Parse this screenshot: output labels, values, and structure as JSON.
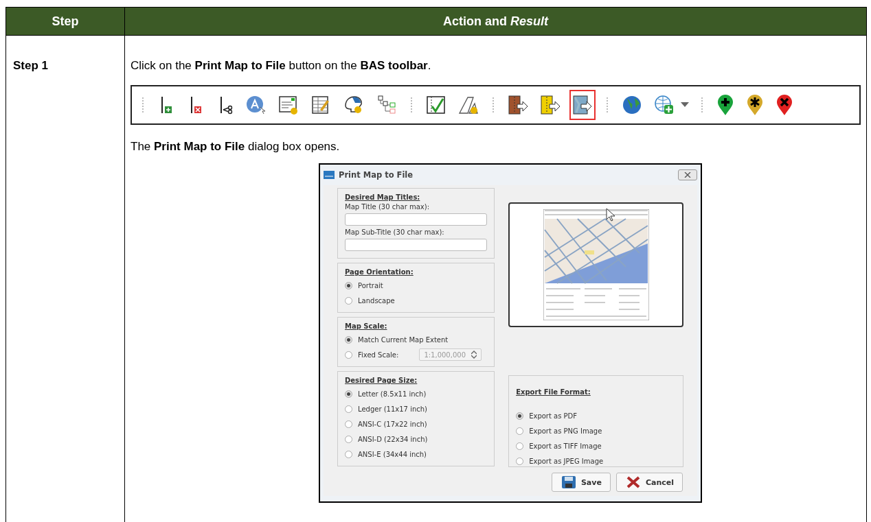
{
  "table": {
    "columns": [
      "Step",
      "Action and *Result*"
    ],
    "rows": [
      {
        "step": "Step 1",
        "instruction": "Click on the **Print Map to File** button on the **BAS toolbar**.",
        "toolbar": {
          "groups": [
            {
              "buttons": [
                {
                  "kind": "line-add",
                  "highlighted": false
                },
                {
                  "kind": "line-delete",
                  "highlighted": false
                },
                {
                  "kind": "line-split",
                  "highlighted": false
                },
                {
                  "kind": "label",
                  "highlighted": false
                },
                {
                  "kind": "form",
                  "highlighted": false
                },
                {
                  "kind": "table",
                  "highlighted": false
                },
                {
                  "kind": "boundary",
                  "highlighted": false
                },
                {
                  "kind": "tree",
                  "highlighted": false
                }
              ]
            },
            {
              "buttons": [
                {
                  "kind": "check",
                  "highlighted": false
                },
                {
                  "kind": "polygon",
                  "highlighted": false
                }
              ]
            },
            {
              "buttons": [
                {
                  "kind": "import",
                  "highlighted": false
                },
                {
                  "kind": "export",
                  "highlighted": false
                },
                {
                  "kind": "print",
                  "highlighted": true
                }
              ]
            },
            {
              "buttons": [
                {
                  "kind": "globe",
                  "highlighted": false
                },
                {
                  "kind": "web-add",
                  "highlighted": false
                },
                {
                  "kind": "dropdown",
                  "highlighted": false
                }
              ]
            },
            {
              "buttons": [
                {
                  "kind": "pin-add",
                  "highlighted": false
                },
                {
                  "kind": "pin-star",
                  "highlighted": false
                },
                {
                  "kind": "pin-remove",
                  "highlighted": false
                }
              ]
            }
          ]
        },
        "result": "The **Print Map to File** dialog box opens.",
        "dialog": {
          "title": "Print Map to File",
          "titles_group": {
            "heading": "Desired Map Titles:",
            "fields": [
              {
                "label": "Map Title (30 char max):"
              },
              {
                "label": "Map Sub-Title (30 char max):"
              }
            ]
          },
          "orientation_group": {
            "heading": "Page Orientation:",
            "options": [
              {
                "label": "Portrait",
                "selected": true
              },
              {
                "label": "Landscape",
                "selected": false
              }
            ]
          },
          "scale_group": {
            "heading": "Map Scale:",
            "options": [
              {
                "label": "Match Current Map Extent",
                "selected": true
              },
              {
                "label": "Fixed Scale:",
                "selected": false
              }
            ],
            "scale_value": "1:1,000,000",
            "scale_disabled": true
          },
          "page_size_group": {
            "heading": "Desired Page Size:",
            "options": [
              {
                "label": "Letter (8.5x11 inch)",
                "selected": true
              },
              {
                "label": "Ledger (11x17 inch)",
                "selected": false
              },
              {
                "label": "ANSI-C (17x22 inch)",
                "selected": false
              },
              {
                "label": "ANSI-D (22x34 inch)",
                "selected": false
              },
              {
                "label": "ANSI-E (34x44 inch)",
                "selected": false
              }
            ]
          },
          "format_group": {
            "heading": "Export File Format:",
            "options": [
              {
                "label": "Export as PDF",
                "selected": true
              },
              {
                "label": "Export as PNG Image",
                "selected": false
              },
              {
                "label": "Export as TIFF Image",
                "selected": false
              },
              {
                "label": "Export as JPEG Image",
                "selected": false
              }
            ]
          },
          "buttons": [
            {
              "kind": "save",
              "label": "Save"
            },
            {
              "kind": "cancel",
              "label": "Cancel"
            }
          ]
        }
      }
    ]
  }
}
